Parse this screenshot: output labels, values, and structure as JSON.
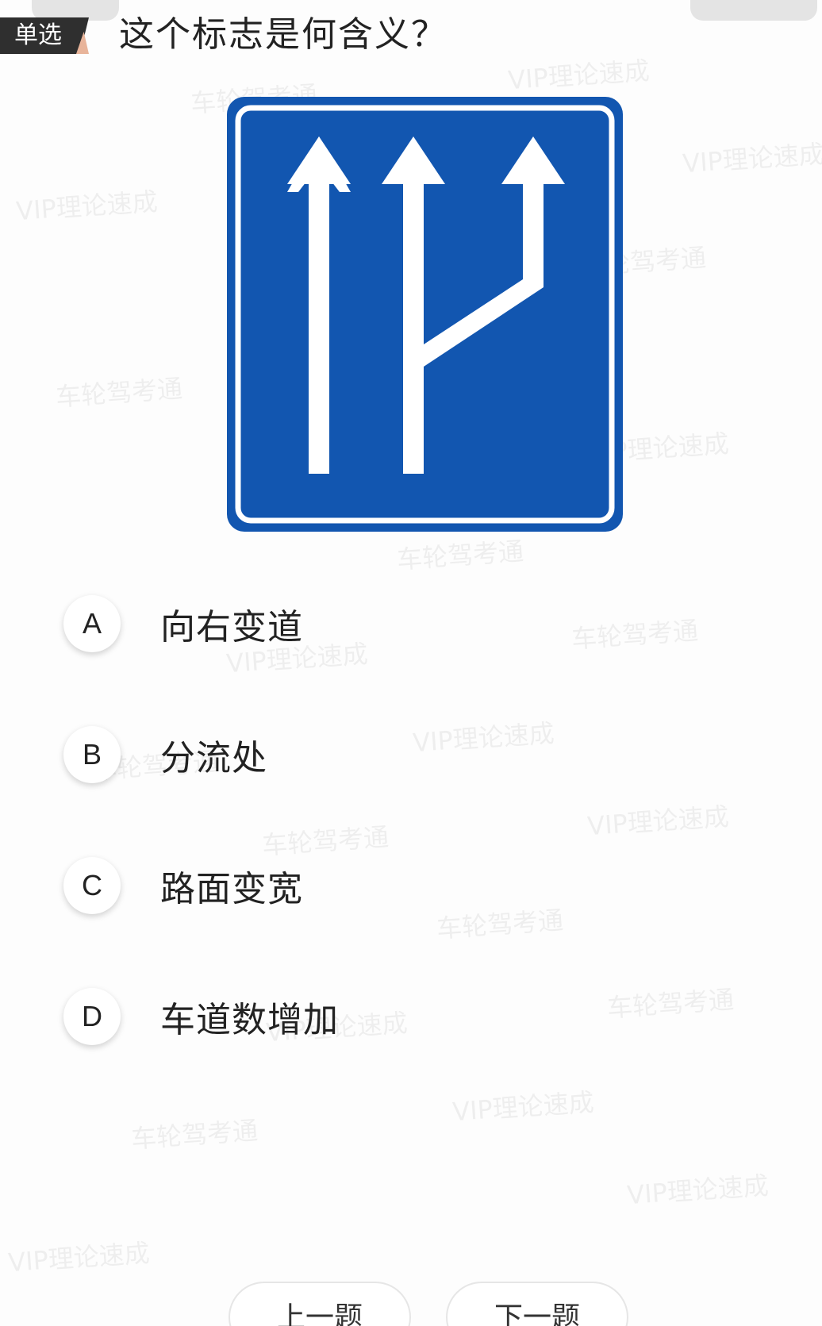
{
  "question": {
    "type_label": "单选",
    "text": "这个标志是何含义？"
  },
  "sign": {
    "icon": "lane-increase-sign",
    "background_color": "#1256b0",
    "border_color": "#ffffff"
  },
  "options": [
    {
      "letter": "A",
      "text": "向右变道"
    },
    {
      "letter": "B",
      "text": "分流处"
    },
    {
      "letter": "C",
      "text": "路面变宽"
    },
    {
      "letter": "D",
      "text": "车道数增加"
    }
  ],
  "navigation": {
    "prev_label": "上一题",
    "next_label": "下一题"
  },
  "watermarks": {
    "brand_a": "VIP理论速成",
    "brand_b": "车轮驾考通"
  }
}
